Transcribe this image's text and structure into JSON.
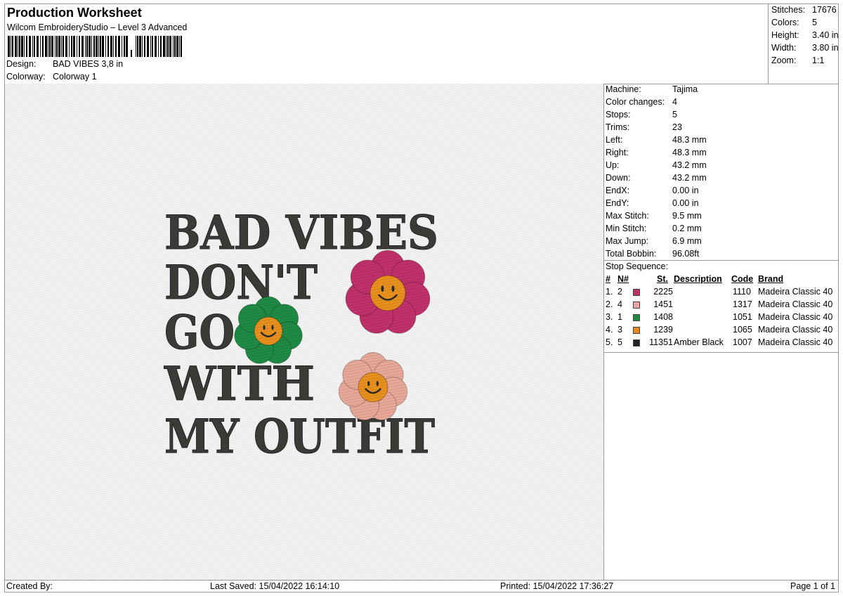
{
  "header": {
    "title": "Production Worksheet",
    "software": "Wilcom EmbroideryStudio – Level 3 Advanced",
    "design_label": "Design:",
    "design_value": "BAD VIBES 3,8 in",
    "colorway_label": "Colorway:",
    "colorway_value": "Colorway 1"
  },
  "stats": [
    {
      "label": "Stitches:",
      "value": "17676"
    },
    {
      "label": "Colors:",
      "value": "5"
    },
    {
      "label": "Height:",
      "value": "3.40 in"
    },
    {
      "label": "Width:",
      "value": "3.80 in"
    },
    {
      "label": "Zoom:",
      "value": "1:1"
    }
  ],
  "design_text": [
    "BAD VIBES",
    "DON'T",
    "GO",
    "WITH",
    "MY OUTFIT"
  ],
  "specs": [
    {
      "label": "Machine:",
      "value": "Tajima"
    },
    {
      "label": "Color changes:",
      "value": "4"
    },
    {
      "label": "Stops:",
      "value": "5"
    },
    {
      "label": "Trims:",
      "value": "23"
    },
    {
      "label": "Left:",
      "value": "48.3 mm"
    },
    {
      "label": "Right:",
      "value": "48.3 mm"
    },
    {
      "label": "Up:",
      "value": "43.2 mm"
    },
    {
      "label": "Down:",
      "value": "43.2 mm"
    },
    {
      "label": "EndX:",
      "value": "0.00 in"
    },
    {
      "label": "EndY:",
      "value": "0.00 in"
    },
    {
      "label": "Max Stitch:",
      "value": "9.5 mm"
    },
    {
      "label": "Min Stitch:",
      "value": "0.2 mm"
    },
    {
      "label": "Max Jump:",
      "value": "6.9 mm"
    },
    {
      "label": "Total Bobbin:",
      "value": "96.08ft"
    }
  ],
  "stop_sequence": {
    "label": "Stop Sequence:",
    "headers": {
      "num": "#",
      "n": "N#",
      "st": "St.",
      "description": "Description",
      "code": "Code",
      "brand": "Brand"
    },
    "rows": [
      {
        "num": "1.",
        "n": "2",
        "color": "#c0306a",
        "st": "2225",
        "description": "",
        "code": "1110",
        "brand": "Madeira Classic 40"
      },
      {
        "num": "2.",
        "n": "4",
        "color": "#e8a8a0",
        "st": "1451",
        "description": "",
        "code": "1317",
        "brand": "Madeira Classic 40"
      },
      {
        "num": "3.",
        "n": "1",
        "color": "#1e8a44",
        "st": "1408",
        "description": "",
        "code": "1051",
        "brand": "Madeira Classic 40"
      },
      {
        "num": "4.",
        "n": "3",
        "color": "#e88a1e",
        "st": "1239",
        "description": "",
        "code": "1065",
        "brand": "Madeira Classic 40"
      },
      {
        "num": "5.",
        "n": "5",
        "color": "#222222",
        "st": "11351",
        "description": "Amber Black",
        "code": "1007",
        "brand": "Madeira Classic 40"
      }
    ]
  },
  "footer": {
    "created_by": "Created By:",
    "last_saved": "Last Saved: 15/04/2022 16:14:10",
    "printed": "Printed: 15/04/2022 17:36:27",
    "page": "Page 1 of 1"
  }
}
